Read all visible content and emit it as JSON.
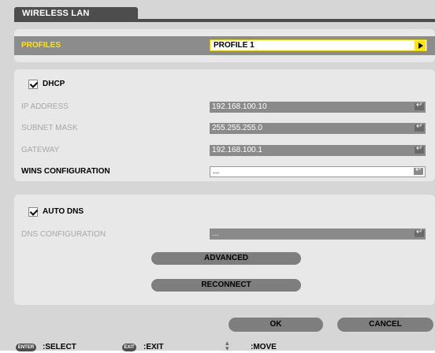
{
  "window": {
    "title": "WIRELESS LAN"
  },
  "profiles": {
    "label": "PROFILES",
    "value": "PROFILE 1",
    "arrow_icon": "play-arrow-icon",
    "accent": "#ffe500"
  },
  "dhcp": {
    "label": "DHCP",
    "checked": true
  },
  "ip_address": {
    "label": "IP ADDRESS",
    "value": "192.168.100.10"
  },
  "subnet_mask": {
    "label": "SUBNET MASK",
    "value": "255.255.255.0"
  },
  "gateway": {
    "label": "GATEWAY",
    "value": "192.168.100.1"
  },
  "wins": {
    "label": "WINS CONFIGURATION",
    "value": "..."
  },
  "auto_dns": {
    "label": "AUTO DNS",
    "checked": true
  },
  "dns": {
    "label": "DNS CONFIGURATION",
    "value": "..."
  },
  "buttons": {
    "advanced": "ADVANCED",
    "reconnect": "RECONNECT",
    "ok": "OK",
    "cancel": "CANCEL"
  },
  "footer": {
    "enter_key": "ENTER",
    "select": ":SELECT",
    "exit_key": "EXIT",
    "exit": ":EXIT",
    "move": ":MOVE"
  }
}
